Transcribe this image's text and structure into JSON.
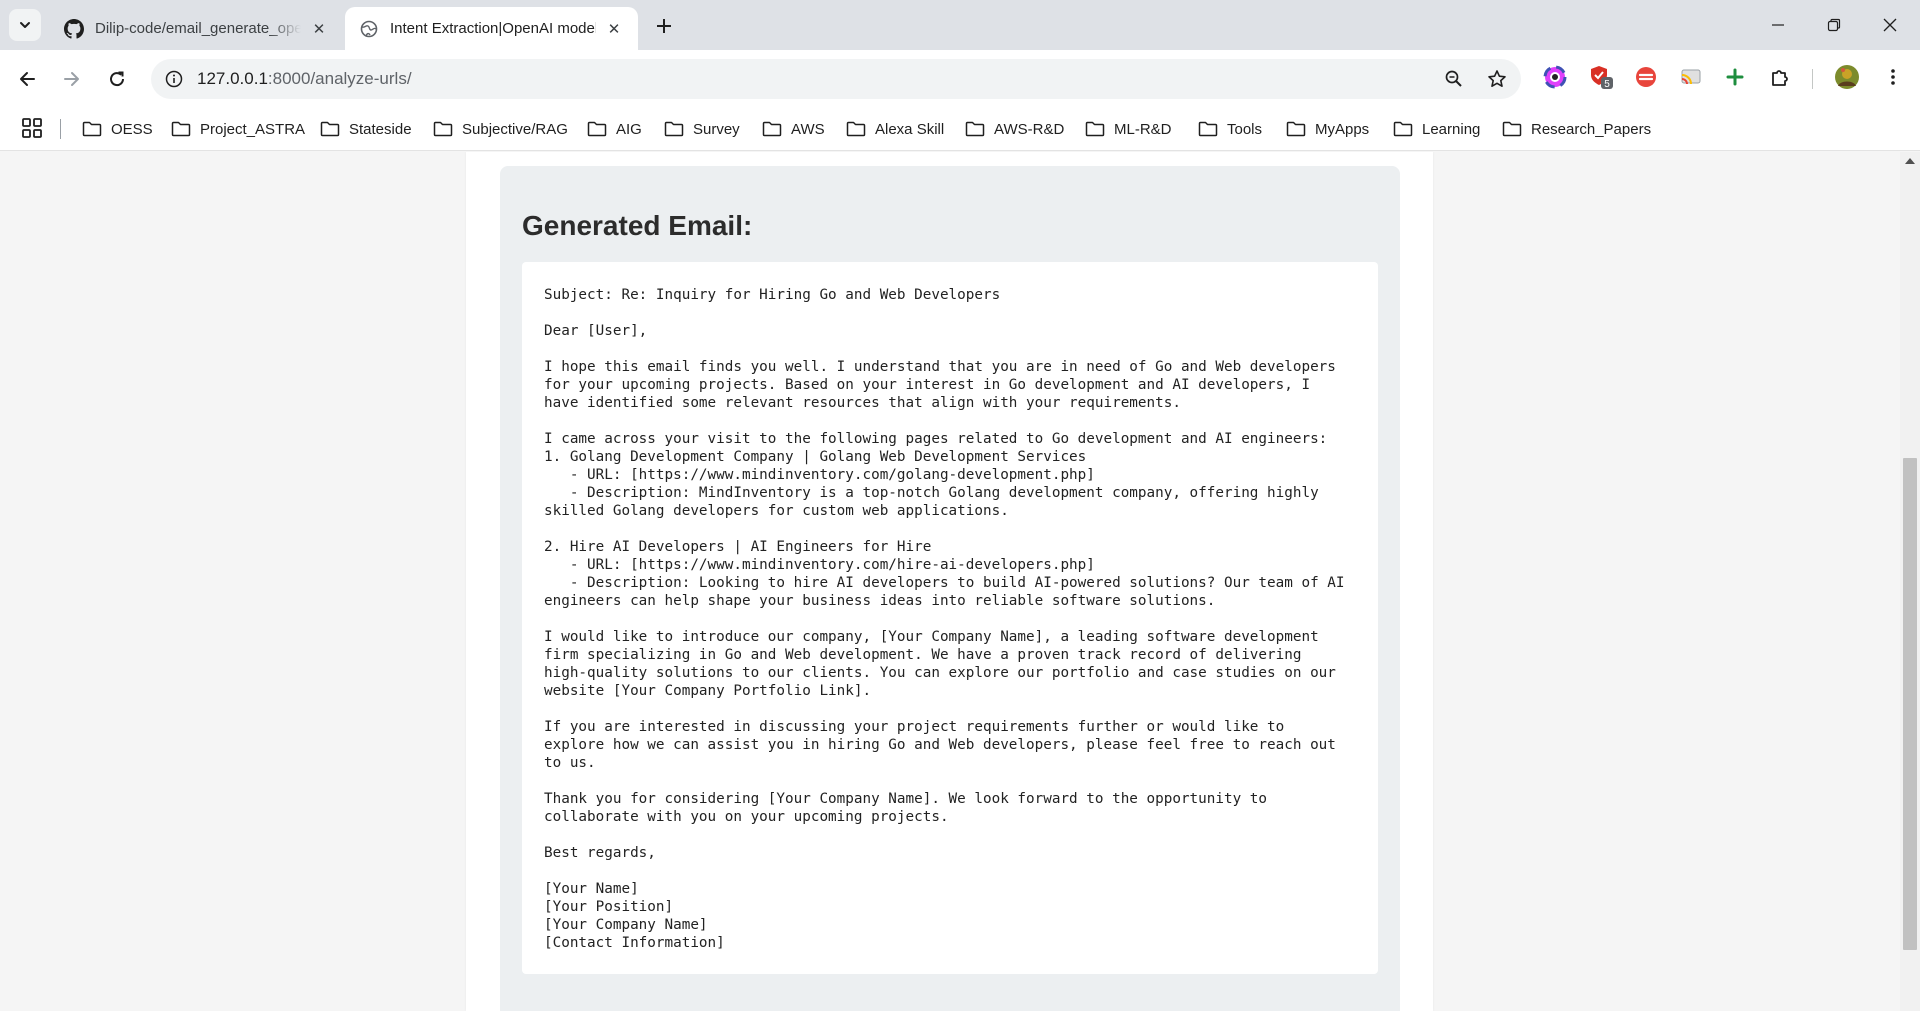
{
  "browser": {
    "tabs": [
      {
        "title": "Dilip-code/email_generate_openai",
        "icon": "github-icon",
        "active": false
      },
      {
        "title": "Intent Extraction|OpenAI model",
        "icon": "globe-icon",
        "active": true
      }
    ],
    "address": {
      "host": "127.0.0.1",
      "rest": ":8000/analyze-urls/"
    },
    "extensions": [
      "color-picker-extension-icon",
      "shield-extension-icon",
      "red-extension-icon",
      "cast-extension-icon",
      "plus-extension-icon",
      "puzzle-extensions-icon"
    ],
    "extension_badge": "5",
    "bookmarks": [
      "OESS",
      "Project_ASTRA",
      "Stateside",
      "Subjective/RAG",
      "AIG",
      "Survey",
      "AWS",
      "Alexa Skill",
      "AWS-R&D",
      "ML-R&D",
      "Tools",
      "MyApps",
      "Learning",
      "Research_Papers"
    ]
  },
  "page": {
    "heading": "Generated Email:",
    "email_lines": [
      "Subject: Re: Inquiry for Hiring Go and Web Developers",
      "",
      "Dear [User],",
      "",
      "I hope this email finds you well. I understand that you are in need of Go and Web developers",
      "for your upcoming projects. Based on your interest in Go development and AI developers, I",
      "have identified some relevant resources that align with your requirements.",
      "",
      "I came across your visit to the following pages related to Go development and AI engineers:",
      "1. Golang Development Company | Golang Web Development Services",
      "   - URL: [https://www.mindinventory.com/golang-development.php]",
      "   - Description: MindInventory is a top-notch Golang development company, offering highly",
      "skilled Golang developers for custom web applications.",
      "",
      "2. Hire AI Developers | AI Engineers for Hire",
      "   - URL: [https://www.mindinventory.com/hire-ai-developers.php]",
      "   - Description: Looking to hire AI developers to build AI-powered solutions? Our team of AI",
      "engineers can help shape your business ideas into reliable software solutions.",
      "",
      "I would like to introduce our company, [Your Company Name], a leading software development",
      "firm specializing in Go and Web development. We have a proven track record of delivering",
      "high-quality solutions to our clients. You can explore our portfolio and case studies on our",
      "website [Your Company Portfolio Link].",
      "",
      "If you are interested in discussing your project requirements further or would like to",
      "explore how we can assist you in hiring Go and Web developers, please feel free to reach out",
      "to us.",
      "",
      "Thank you for considering [Your Company Name]. We look forward to the opportunity to",
      "collaborate with you on your upcoming projects.",
      "",
      "Best regards,",
      "",
      "[Your Name]",
      "[Your Position]",
      "[Your Company Name]",
      "[Contact Information]"
    ]
  }
}
